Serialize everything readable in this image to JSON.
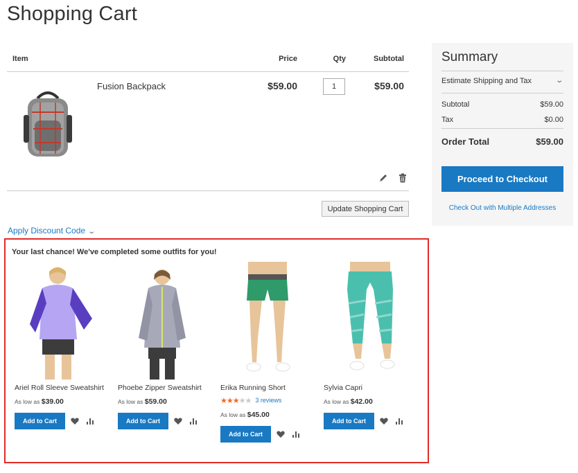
{
  "page": {
    "title": "Shopping Cart"
  },
  "cart": {
    "headers": {
      "item": "Item",
      "price": "Price",
      "qty": "Qty",
      "subtotal": "Subtotal"
    },
    "items": [
      {
        "name": "Fusion Backpack",
        "price": "$59.00",
        "qty": "1",
        "subtotal": "$59.00"
      }
    ],
    "update_label": "Update Shopping Cart",
    "discount_label": "Apply Discount Code"
  },
  "summary": {
    "title": "Summary",
    "estimate_label": "Estimate Shipping and Tax",
    "subtotal_label": "Subtotal",
    "subtotal_value": "$59.00",
    "tax_label": "Tax",
    "tax_value": "$0.00",
    "total_label": "Order Total",
    "total_value": "$59.00",
    "checkout_label": "Proceed to Checkout",
    "multi_address_label": "Check Out with Multiple Addresses"
  },
  "outfits": {
    "title": "Your last chance! We've completed some outfits for you!",
    "products": [
      {
        "name": "Ariel Roll Sleeve Sweatshirt",
        "price_prefix": "As low as",
        "price": "$39.00",
        "add_label": "Add to Cart",
        "color": "#9c8ce6"
      },
      {
        "name": "Phoebe Zipper Sweatshirt",
        "price_prefix": "As low as",
        "price": "$59.00",
        "add_label": "Add to Cart",
        "color": "#a7a9b8"
      },
      {
        "name": "Erika Running Short",
        "price_prefix": "As low as",
        "price": "$45.00",
        "add_label": "Add to Cart",
        "rating": 3,
        "reviews": "3 reviews",
        "color": "#2f9a6a"
      },
      {
        "name": "Sylvia Capri",
        "price_prefix": "As low as",
        "price": "$42.00",
        "add_label": "Add to Cart",
        "color": "#4bbfae"
      }
    ]
  },
  "colors": {
    "accent": "#1979c3",
    "highlight_border": "#e02b27",
    "star": "#e96c2b"
  },
  "icons": {
    "edit": "pencil-icon",
    "delete": "trash-icon",
    "wishlist": "heart-icon",
    "compare": "bar-chart-icon",
    "expand": "chevron-down-icon"
  }
}
